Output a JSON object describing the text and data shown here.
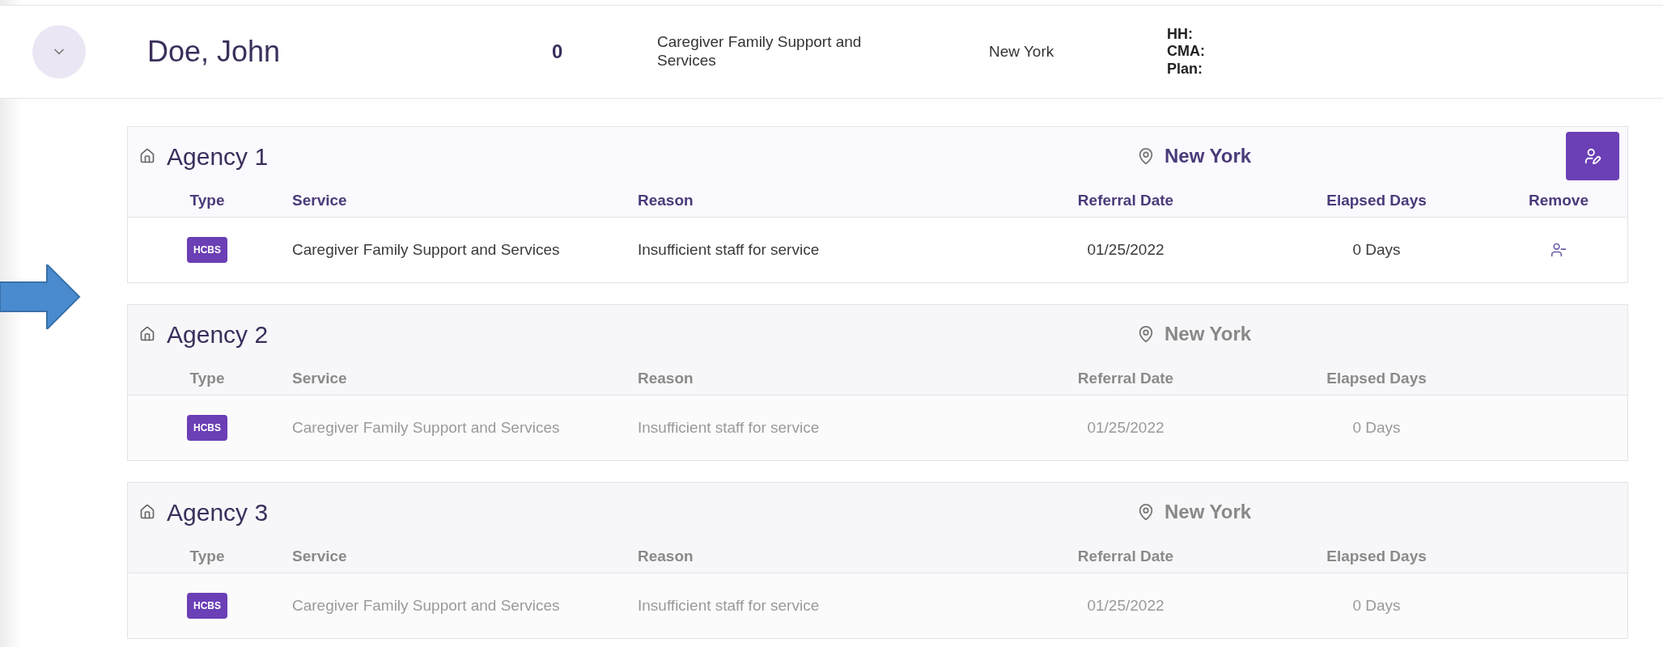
{
  "record": {
    "expanded": true,
    "name": "Doe, John",
    "count": "0",
    "service": "Caregiver Family Support and Services",
    "location": "New York",
    "labels": [
      "HH:",
      "CMA:",
      "Plan:"
    ]
  },
  "agencies": [
    {
      "name": "Agency 1",
      "active": true,
      "location": "New York",
      "columns": [
        "Type",
        "Service",
        "Reason",
        "Referral Date",
        "Elapsed Days",
        "Remove"
      ],
      "rows": [
        {
          "type": "HCBS",
          "service": "Caregiver Family Support and Services",
          "reason": "Insufficient staff for service",
          "referral_date": "01/25/2022",
          "elapsed": "0 Days"
        }
      ]
    },
    {
      "name": "Agency 2",
      "active": false,
      "location": "New York",
      "columns": [
        "Type",
        "Service",
        "Reason",
        "Referral Date",
        "Elapsed Days"
      ],
      "rows": [
        {
          "type": "HCBS",
          "service": "Caregiver Family Support and Services",
          "reason": "Insufficient staff for service",
          "referral_date": "01/25/2022",
          "elapsed": "0 Days"
        }
      ]
    },
    {
      "name": "Agency 3",
      "active": false,
      "location": "New York",
      "columns": [
        "Type",
        "Service",
        "Reason",
        "Referral Date",
        "Elapsed Days"
      ],
      "rows": [
        {
          "type": "HCBS",
          "service": "Caregiver Family Support and Services",
          "reason": "Insufficient staff for service",
          "referral_date": "01/25/2022",
          "elapsed": "0 Days"
        }
      ]
    }
  ]
}
